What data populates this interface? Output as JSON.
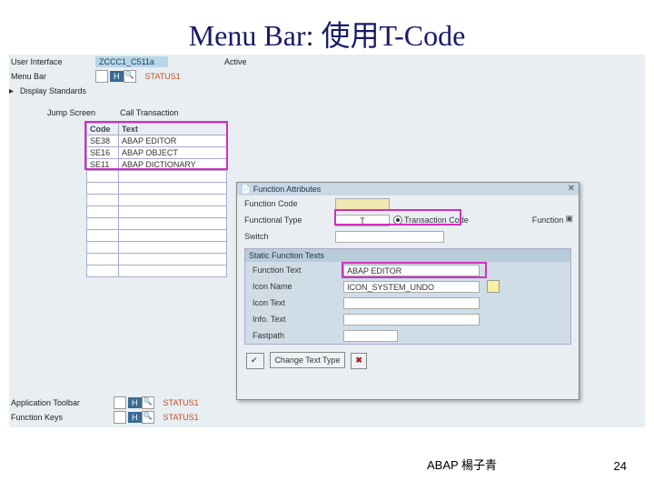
{
  "title": "Menu Bar: 使用T-Code",
  "header": {
    "user_interface_lbl": "User Interface",
    "user_interface_val": "ZCCC1_C511a",
    "status": "Active",
    "menu_bar_lbl": "Menu Bar",
    "display_std_lbl": "Display Standards",
    "status_name": "STATUS1",
    "jump_screen_lbl": "Jump Screen",
    "call_trans_lbl": "Call Transaction"
  },
  "table": {
    "col_code": "Code",
    "col_text": "Text",
    "rows": [
      {
        "code": "SE38",
        "text": "ABAP EDITOR"
      },
      {
        "code": "SE16",
        "text": "ABAP OBJECT"
      },
      {
        "code": "SE11",
        "text": "ABAP DICTIONARY"
      }
    ]
  },
  "dialog": {
    "title": "Function Attributes",
    "func_code_lbl": "Function Code",
    "func_type_lbl": "Functional Type",
    "radio_lbl": "Transaction Code",
    "func_lbl": "Function",
    "switch_lbl": "Switch",
    "panel_title": "Static Function Texts",
    "func_text_lbl": "Function Text",
    "func_text_val": "ABAP EDITOR",
    "icon_name_lbl": "Icon Name",
    "icon_name_val": "ICON_SYSTEM_UNDO",
    "icon_text_lbl": "Icon Text",
    "info_text_lbl": "Info. Text",
    "fastpath_lbl": "Fastpath",
    "change_btn": "Change Text Type",
    "seq_icon": "▣"
  },
  "bottom": {
    "app_tb_lbl": "Application Toolbar",
    "app_tb_val": "STATUS1",
    "func_keys_lbl": "Function Keys",
    "func_keys_val": "STATUS1"
  },
  "footer": {
    "author": "ABAP 楊子青",
    "page": "24"
  }
}
